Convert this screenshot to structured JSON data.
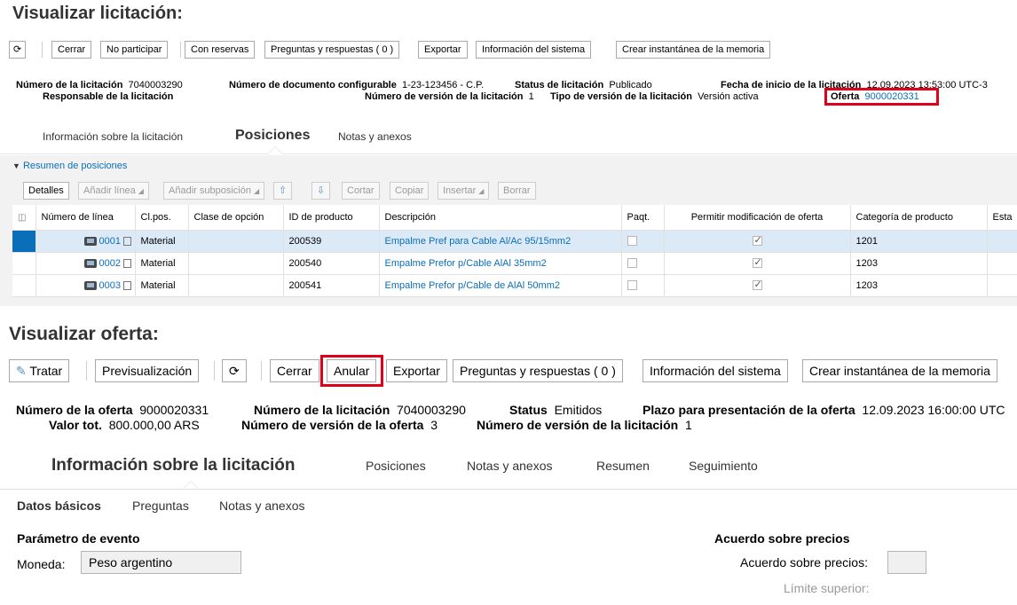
{
  "p1": {
    "title": "Visualizar licitación:",
    "toolbar": {
      "refresh_icon": "refresh-icon",
      "cerrar": "Cerrar",
      "no_participar": "No participar",
      "con_reservas": "Con reservas",
      "preguntas": "Preguntas y respuestas ( 0 )",
      "exportar": "Exportar",
      "info_sistema": "Información del sistema",
      "instantanea": "Crear instantánea de la memoria"
    },
    "header": {
      "numero_licitacion_label": "Número de la licitación",
      "numero_licitacion_value": "7040003290",
      "responsable_label": "Responsable de la licitación",
      "num_doc_label": "Número de documento configurable",
      "num_doc_value": "1-23-123456 - C.P.",
      "num_version_label": "Número de versión de la licitación",
      "num_version_value": "1",
      "status_label": "Status de licitación",
      "status_value": "Publicado",
      "tipo_version_label": "Tipo de versión de la licitación",
      "tipo_version_value": "Versión activa",
      "fecha_inicio_label": "Fecha de inicio de la licitación",
      "fecha_inicio_value": "12.09.2023 13:53:00 UTC-3",
      "oferta_label": "Oferta",
      "oferta_value": "9000020331"
    },
    "tabs": {
      "info": "Información sobre la licitación",
      "posiciones": "Posiciones",
      "notas": "Notas y anexos"
    },
    "summary_title": "Resumen de posiciones",
    "toolbar2": {
      "detalles": "Detalles",
      "anadir_linea": "Añadir línea",
      "anadir_subposicion": "Añadir subposición",
      "up_icon": "arrow-up-icon",
      "down_icon": "arrow-down-icon",
      "cortar": "Cortar",
      "copiar": "Copiar",
      "insertar": "Insertar",
      "borrar": "Borrar"
    },
    "columns": [
      "Número de línea",
      "Cl.pos.",
      "Clase de opción",
      "ID de producto",
      "Descripción",
      "Paqt.",
      "Permitir modificación de oferta",
      "Categoría de producto",
      "Esta"
    ],
    "rows": [
      {
        "line": "0001",
        "clpos": "Material",
        "clase": "",
        "id": "200539",
        "desc": "Empalme Pref para Cable Al/Ac 95/15mm2",
        "paqt": false,
        "permitir": true,
        "categoria": "1201"
      },
      {
        "line": "0002",
        "clpos": "Material",
        "clase": "",
        "id": "200540",
        "desc": "Empalme Prefor p/Cable AlAl 35mm2",
        "paqt": false,
        "permitir": true,
        "categoria": "1203"
      },
      {
        "line": "0003",
        "clpos": "Material",
        "clase": "",
        "id": "200541",
        "desc": "Empalme Prefor p/Cable de AlAl 50mm2",
        "paqt": false,
        "permitir": true,
        "categoria": "1203"
      }
    ]
  },
  "p2": {
    "title": "Visualizar oferta:",
    "toolbar": {
      "tratar": "Tratar",
      "previsualizacion": "Previsualización",
      "refresh_icon": "refresh-icon",
      "cerrar": "Cerrar",
      "anular": "Anular",
      "exportar": "Exportar",
      "preguntas": "Preguntas y respuestas ( 0 )",
      "info_sistema": "Información del sistema",
      "instantanea": "Crear instantánea de la memoria"
    },
    "header": {
      "numero_oferta_label": "Número de la oferta",
      "numero_oferta_value": "9000020331",
      "valor_label": "Valor tot.",
      "valor_value": "800.000,00 ARS",
      "numero_licitacion_label": "Número de la licitación",
      "numero_licitacion_value": "7040003290",
      "num_version_oferta_label": "Número de versión de la oferta",
      "num_version_oferta_value": "3",
      "status_label": "Status",
      "status_value": "Emitidos",
      "num_version_licit_label": "Número de versión de la licitación",
      "num_version_licit_value": "1",
      "plazo_label": "Plazo para presentación de la oferta",
      "plazo_value": "12.09.2023 16:00:00 UTC"
    },
    "tabs": {
      "info": "Información sobre la licitación",
      "posiciones": "Posiciones",
      "notas": "Notas y anexos",
      "resumen": "Resumen",
      "seguimiento": "Seguimiento"
    },
    "subtabs": {
      "datos": "Datos básicos",
      "preguntas": "Preguntas",
      "notas": "Notas y anexos"
    },
    "parametro_evento": "Parámetro de evento",
    "moneda_label": "Moneda:",
    "moneda_value": "Peso argentino",
    "acuerdo_title": "Acuerdo sobre precios",
    "acuerdo_label": "Acuerdo sobre precios:",
    "limite_label": "Límite superior:"
  },
  "colors": {
    "link": "#0a6fb8",
    "highlight": "#e0001a",
    "selected_row": "#dbeaf6"
  }
}
